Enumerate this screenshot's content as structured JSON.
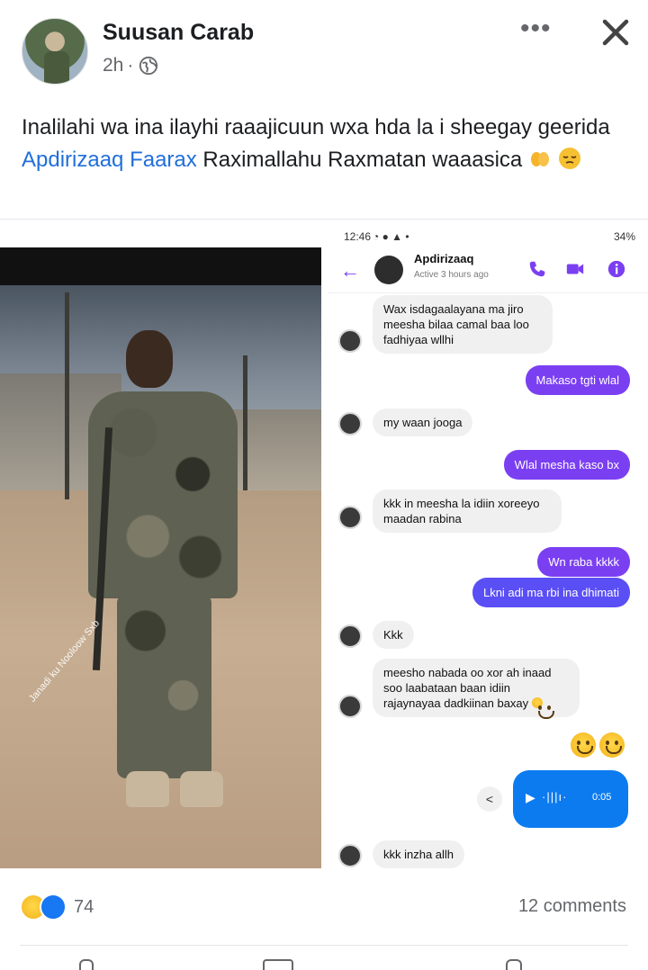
{
  "post": {
    "author": "Suusan Carab",
    "time": "2h",
    "meta_separator": "·",
    "text_before": "Inalilahi wa ina ilayhi raaajicuun wxa hda la i sheegay geerida ",
    "tag": "Apdirizaaq Faarax",
    "text_after": "   Raximallahu Raxmatan waaasica"
  },
  "photo": {
    "watermark": "Janadi ku Nooloow Sxb"
  },
  "chat": {
    "status_time": "12:46",
    "status_right": "34%",
    "contact_name": "Apdirizaaq",
    "contact_status": "Active 3 hours ago",
    "messages": [
      {
        "dir": "in",
        "text": "Wax isdagaalayana ma jiro meesha bilaa camal baa loo fadhiyaa wllhi"
      },
      {
        "dir": "out",
        "text": "Makaso tgti wlal"
      },
      {
        "dir": "in",
        "text": "my waan jooga"
      },
      {
        "dir": "out",
        "text": "Wlal mesha kaso bx"
      },
      {
        "dir": "in",
        "text": "kkk in meesha la idiin xoreeyo maadan rabina"
      },
      {
        "dir": "out",
        "text": "Wn raba kkkk"
      },
      {
        "dir": "out",
        "text": "Lkni adi ma rbi ina dhimati"
      },
      {
        "dir": "in",
        "text": "Kkk"
      },
      {
        "dir": "in",
        "text": "meesho nabada oo xor ah inaad soo laabataan baan idiin rajaynayaa dadkiinan baxay"
      },
      {
        "dir": "in",
        "text": "kkk inzha allh"
      }
    ],
    "voice_duration": "0:05"
  },
  "footer": {
    "reaction_count": "74",
    "comments": "12 comments"
  },
  "colors": {
    "messenger_purple": "#7b3ff2",
    "facebook_blue": "#1877f2",
    "voice_blue": "#0d7bf0",
    "tag_blue": "#216fdb"
  },
  "icons": [
    "globe-icon",
    "more-icon",
    "close-icon",
    "back-arrow-icon",
    "phone-icon",
    "video-icon",
    "info-icon",
    "share-icon",
    "play-icon",
    "sad-reaction-icon",
    "like-reaction-icon"
  ]
}
